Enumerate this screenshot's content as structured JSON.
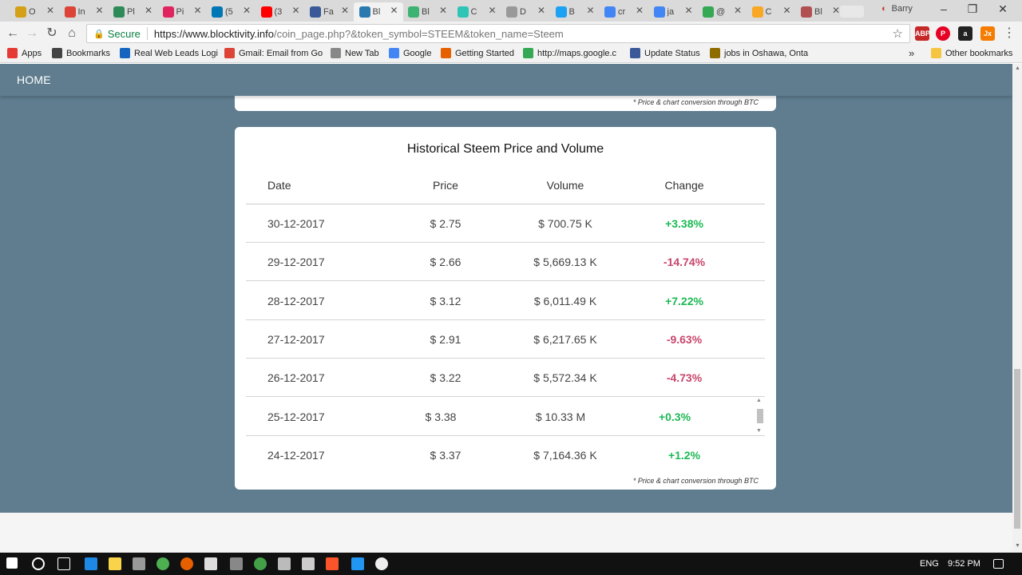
{
  "browser": {
    "tabs": [
      {
        "label": "O",
        "color": "#d4a017"
      },
      {
        "label": "In",
        "color": "#db4437"
      },
      {
        "label": "Pl",
        "color": "#2e8b57"
      },
      {
        "label": "Pi",
        "color": "#e0245e"
      },
      {
        "label": "(5",
        "color": "#0077b5"
      },
      {
        "label": "(3",
        "color": "#ff0000"
      },
      {
        "label": "Fa",
        "color": "#3b5998"
      },
      {
        "label": "Bl",
        "color": "#2a7ab0"
      },
      {
        "label": "Bl",
        "color": "#3cb371"
      },
      {
        "label": "C",
        "color": "#2ec4b6"
      },
      {
        "label": "D",
        "color": "#999999"
      },
      {
        "label": "B",
        "color": "#1da1f2"
      },
      {
        "label": "cr",
        "color": "#4285f4"
      },
      {
        "label": "ja",
        "color": "#4285f4"
      },
      {
        "label": "@",
        "color": "#34a853"
      },
      {
        "label": "C",
        "color": "#f9a825"
      },
      {
        "label": "Bl",
        "color": "#b05050"
      }
    ],
    "active_tab_index": 7,
    "profile_name": "Barry",
    "omnibox": {
      "secure_label": "Secure",
      "url_host": "https://www.blocktivity.info",
      "url_rest": "/coin_page.php?&token_symbol=STEEM&token_name=Steem"
    },
    "bookmarks": [
      {
        "label": "Apps",
        "color": "#e53935"
      },
      {
        "label": "Bookmarks",
        "color": "#444444"
      },
      {
        "label": "Real Web Leads Logi",
        "color": "#1565c0"
      },
      {
        "label": "Gmail: Email from Go",
        "color": "#db4437"
      },
      {
        "label": "New Tab",
        "color": "#888888"
      },
      {
        "label": "Google",
        "color": "#4285f4"
      },
      {
        "label": "Getting Started",
        "color": "#e66000"
      },
      {
        "label": "http://maps.google.c",
        "color": "#34a853"
      },
      {
        "label": "Update Status",
        "color": "#3b5998"
      },
      {
        "label": "jobs in Oshawa, Onta",
        "color": "#8e6c00"
      }
    ],
    "more_bookmarks": "»",
    "other_bookmarks": "Other bookmarks"
  },
  "page": {
    "nav_home": "HOME",
    "conversion_note": "* Price & chart conversion through BTC",
    "table_title": "Historical Steem Price and Volume",
    "columns": [
      "Date",
      "Price",
      "Volume",
      "Change"
    ],
    "rows": [
      {
        "date": "30-12-2017",
        "price": "$ 2.75",
        "volume": "$ 700.75 K",
        "change": "+3.38%",
        "dir": "pos"
      },
      {
        "date": "29-12-2017",
        "price": "$ 2.66",
        "volume": "$ 5,669.13 K",
        "change": "-14.74%",
        "dir": "neg"
      },
      {
        "date": "28-12-2017",
        "price": "$ 3.12",
        "volume": "$ 6,011.49 K",
        "change": "+7.22%",
        "dir": "pos"
      },
      {
        "date": "27-12-2017",
        "price": "$ 2.91",
        "volume": "$ 6,217.65 K",
        "change": "-9.63%",
        "dir": "neg"
      },
      {
        "date": "26-12-2017",
        "price": "$ 3.22",
        "volume": "$ 5,572.34 K",
        "change": "-4.73%",
        "dir": "neg"
      },
      {
        "date": "25-12-2017",
        "price": "$ 3.38",
        "volume": "$ 10.33 M",
        "change": "+0.3%",
        "dir": "pos"
      },
      {
        "date": "24-12-2017",
        "price": "$ 3.37",
        "volume": "$ 7,164.36 K",
        "change": "+1.2%",
        "dir": "pos"
      }
    ]
  },
  "taskbar": {
    "language": "ENG",
    "time": "9:52 PM"
  }
}
